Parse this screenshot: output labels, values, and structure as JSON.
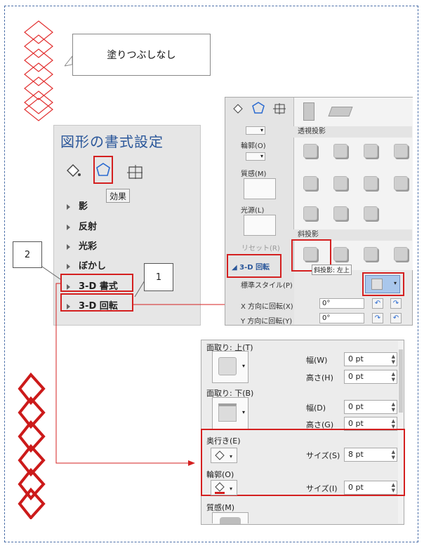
{
  "callout": {
    "text": "塗りつぶしなし"
  },
  "format_panel": {
    "title": "図形の書式設定",
    "tabs": [
      "fill-line-icon",
      "effects-icon",
      "size-properties-icon"
    ],
    "tooltip": "効果",
    "items": [
      "影",
      "反射",
      "光彩",
      "ぼかし",
      "3-D 書式",
      "3-D 回転"
    ]
  },
  "step_labels": {
    "one": "1",
    "two": "2"
  },
  "rotation_panel": {
    "outline_label": "輪郭(O)",
    "material_label": "質感(M)",
    "lighting_label": "光源(L)",
    "reset_label": "リセット(R)",
    "section_label": "3-D 回転",
    "preset_label": "標準スタイル(P)",
    "x_label": "X 方向に回転(X)",
    "y_label": "Y 方向に回転(Y)",
    "x_value": "0°",
    "y_value": "0°",
    "gallery_perspective": "透視投影",
    "gallery_oblique": "斜投影",
    "gallery_tooltip": "斜投影: 左上"
  },
  "format3d_panel": {
    "bevel_top_label": "面取り: 上(T)",
    "bevel_bottom_label": "面取り: 下(B)",
    "width_label": "幅(W)",
    "height_label": "高さ(H)",
    "width2_label": "幅(D)",
    "height2_label": "高さ(G)",
    "depth_label": "奥行き(E)",
    "depth_size_label": "サイズ(S)",
    "contour_label": "輪郭(O)",
    "contour_size_label": "サイズ(I)",
    "material_label": "質感(M)",
    "width_value": "0 pt",
    "height_value": "0 pt",
    "width2_value": "0 pt",
    "height2_value": "0 pt",
    "depth_value": "8 pt",
    "contour_value": "0 pt"
  },
  "colors": {
    "accent_red": "#d42020",
    "title_blue": "#2b579a",
    "frame_blue": "#4a6ea8"
  }
}
